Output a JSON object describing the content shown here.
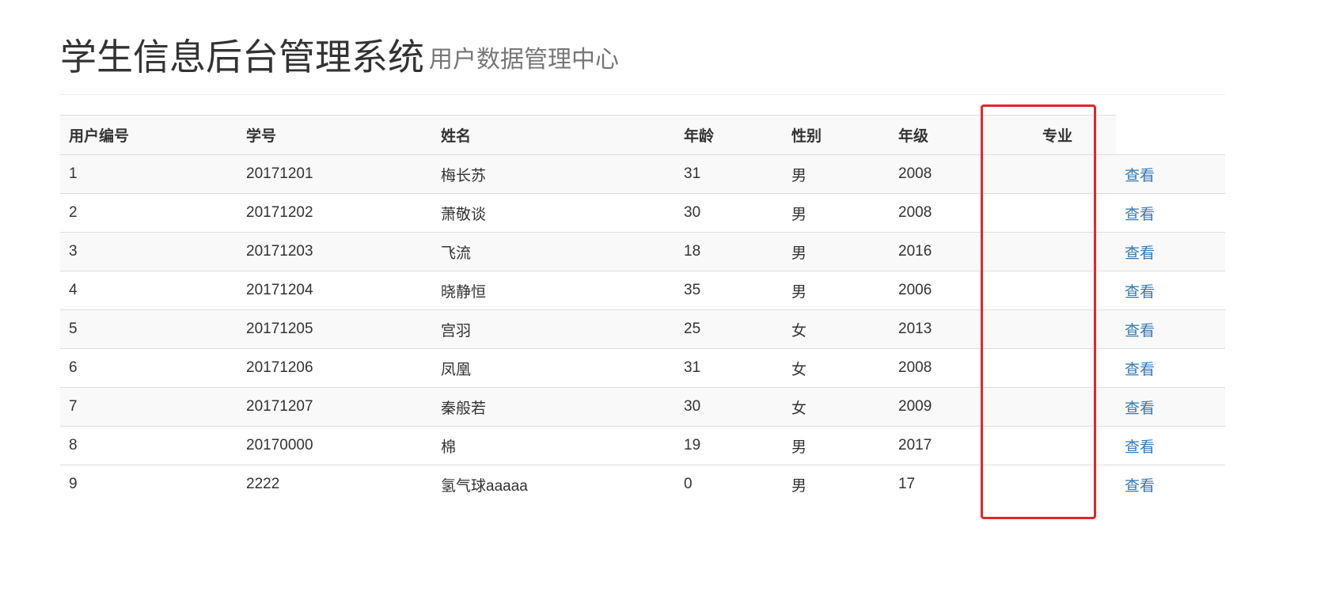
{
  "header": {
    "title": "学生信息后台管理系统",
    "subtitle": "用户数据管理中心"
  },
  "table": {
    "columns": [
      "用户编号",
      "学号",
      "姓名",
      "年龄",
      "性别",
      "年级",
      "专业"
    ],
    "rows": [
      {
        "id": "1",
        "student_no": "20171201",
        "name": "梅长苏",
        "age": "31",
        "gender": "男",
        "grade": "2008",
        "major": "",
        "action": "查看"
      },
      {
        "id": "2",
        "student_no": "20171202",
        "name": "萧敬谈",
        "age": "30",
        "gender": "男",
        "grade": "2008",
        "major": "",
        "action": "查看"
      },
      {
        "id": "3",
        "student_no": "20171203",
        "name": "飞流",
        "age": "18",
        "gender": "男",
        "grade": "2016",
        "major": "",
        "action": "查看"
      },
      {
        "id": "4",
        "student_no": "20171204",
        "name": "晓静恒",
        "age": "35",
        "gender": "男",
        "grade": "2006",
        "major": "",
        "action": "查看"
      },
      {
        "id": "5",
        "student_no": "20171205",
        "name": "宫羽",
        "age": "25",
        "gender": "女",
        "grade": "2013",
        "major": "",
        "action": "查看"
      },
      {
        "id": "6",
        "student_no": "20171206",
        "name": "凤凰",
        "age": "31",
        "gender": "女",
        "grade": "2008",
        "major": "",
        "action": "查看"
      },
      {
        "id": "7",
        "student_no": "20171207",
        "name": "秦般若",
        "age": "30",
        "gender": "女",
        "grade": "2009",
        "major": "",
        "action": "查看"
      },
      {
        "id": "8",
        "student_no": "20170000",
        "name": "棉",
        "age": "19",
        "gender": "男",
        "grade": "2017",
        "major": "",
        "action": "查看"
      },
      {
        "id": "9",
        "student_no": "2222",
        "name": "氢气球aaaaa",
        "age": "0",
        "gender": "男",
        "grade": "17",
        "major": "",
        "action": "查看"
      }
    ]
  },
  "colors": {
    "link": "#337ab7",
    "highlight": "#e3262c",
    "stripe": "#f9f9f9",
    "border": "#dddddd"
  }
}
